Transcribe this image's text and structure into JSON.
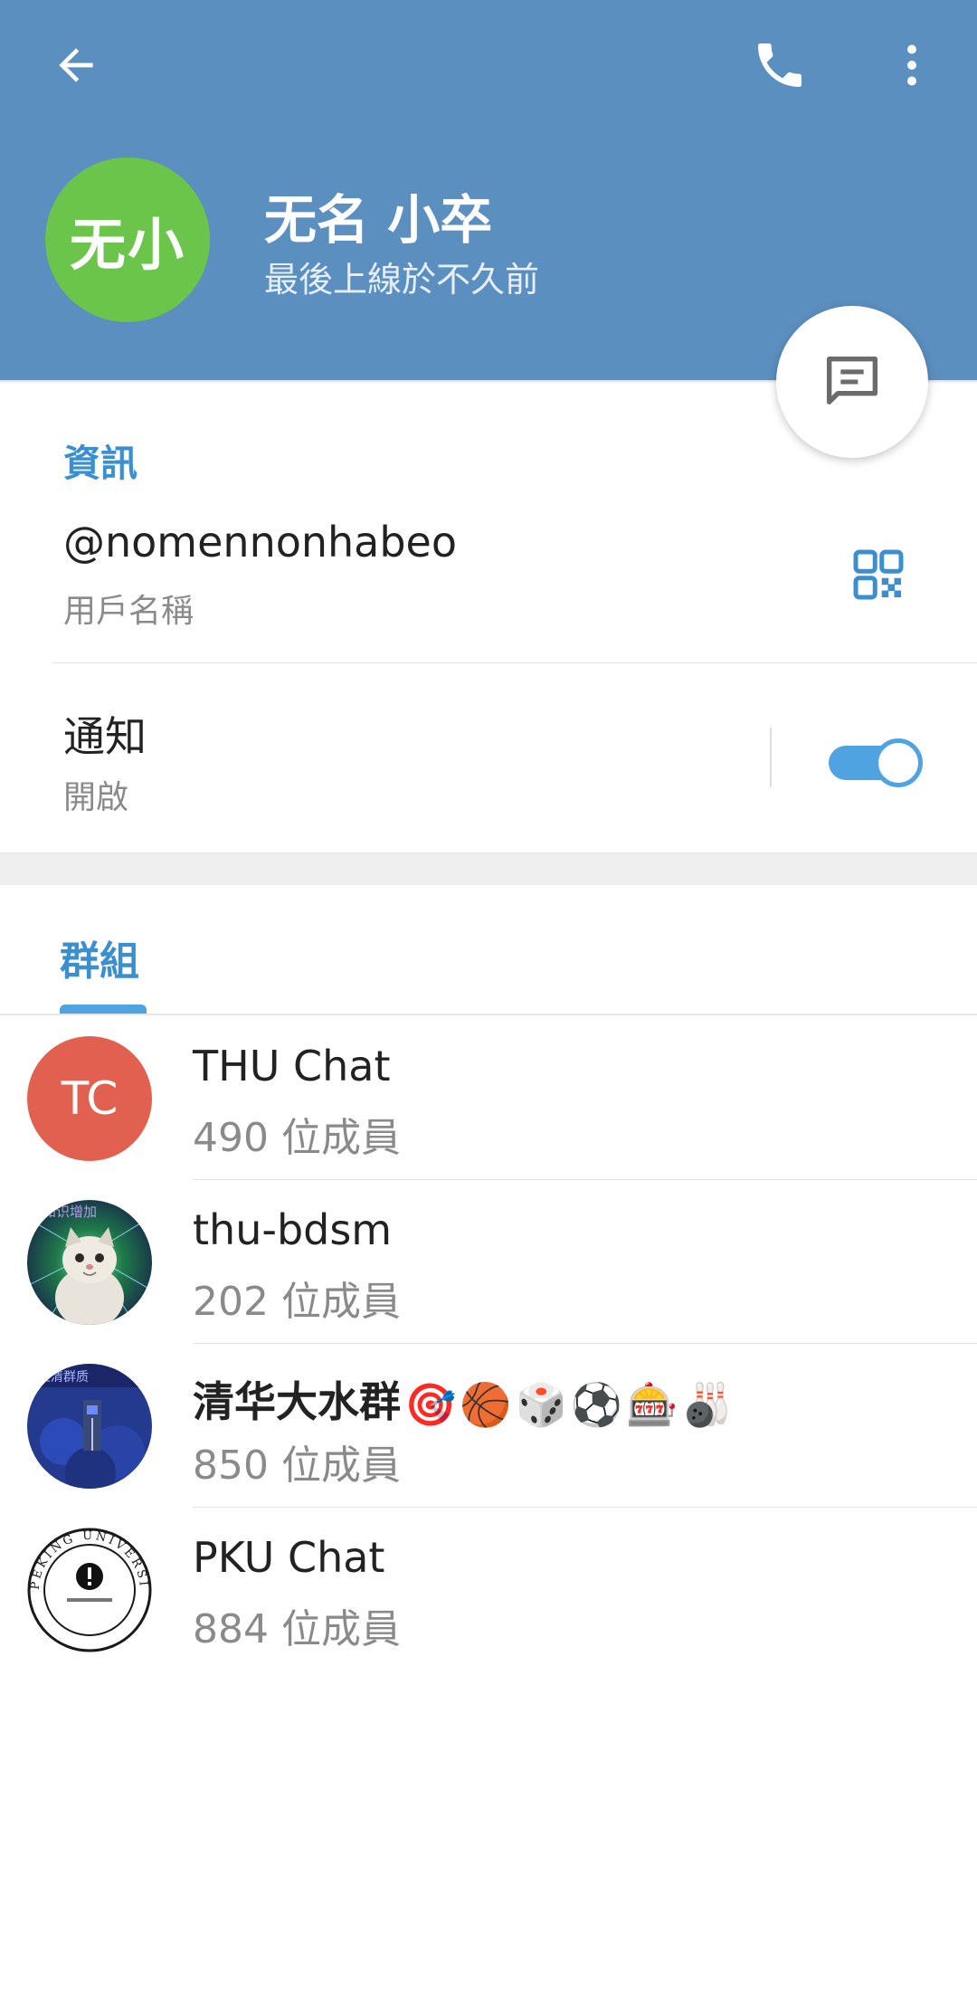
{
  "header": {
    "name": "无名 小卒",
    "status": "最後上線於不久前",
    "avatar_initials": "无小",
    "avatar_color": "#6ac54a",
    "background_color": "#5b8fc0",
    "icons": [
      "arrow-left-icon",
      "phone-icon",
      "more-vertical-icon"
    ]
  },
  "fab": {
    "icon": "message-icon"
  },
  "info": {
    "section_title": "資訊",
    "username": "@nomennonhabeo",
    "username_label": "用戶名稱",
    "qr_icon": "qr-code-icon",
    "notifications_title": "通知",
    "notifications_state": "開啟",
    "notifications_enabled": true
  },
  "groups": {
    "tab_label": "群組",
    "accent_color": "#3b8fcf",
    "items": [
      {
        "name": "THU Chat",
        "members": "490 位成員",
        "avatar_initials": "TC",
        "avatar_color": "#e2604f"
      },
      {
        "name": "thu-bdsm",
        "members": "202 位成員",
        "avatar_text": "的知识增加"
      },
      {
        "name": "清华大水群",
        "emojis": [
          "🎯",
          "🏀",
          "🎲",
          "⚽",
          "🎰",
          "🎳"
        ],
        "members": "850 位成員",
        "avatar_text": "立清群质"
      },
      {
        "name": "PKU Chat",
        "members": "884 位成員",
        "avatar_text": "PEKING UNIVERSITY 1898"
      }
    ]
  }
}
